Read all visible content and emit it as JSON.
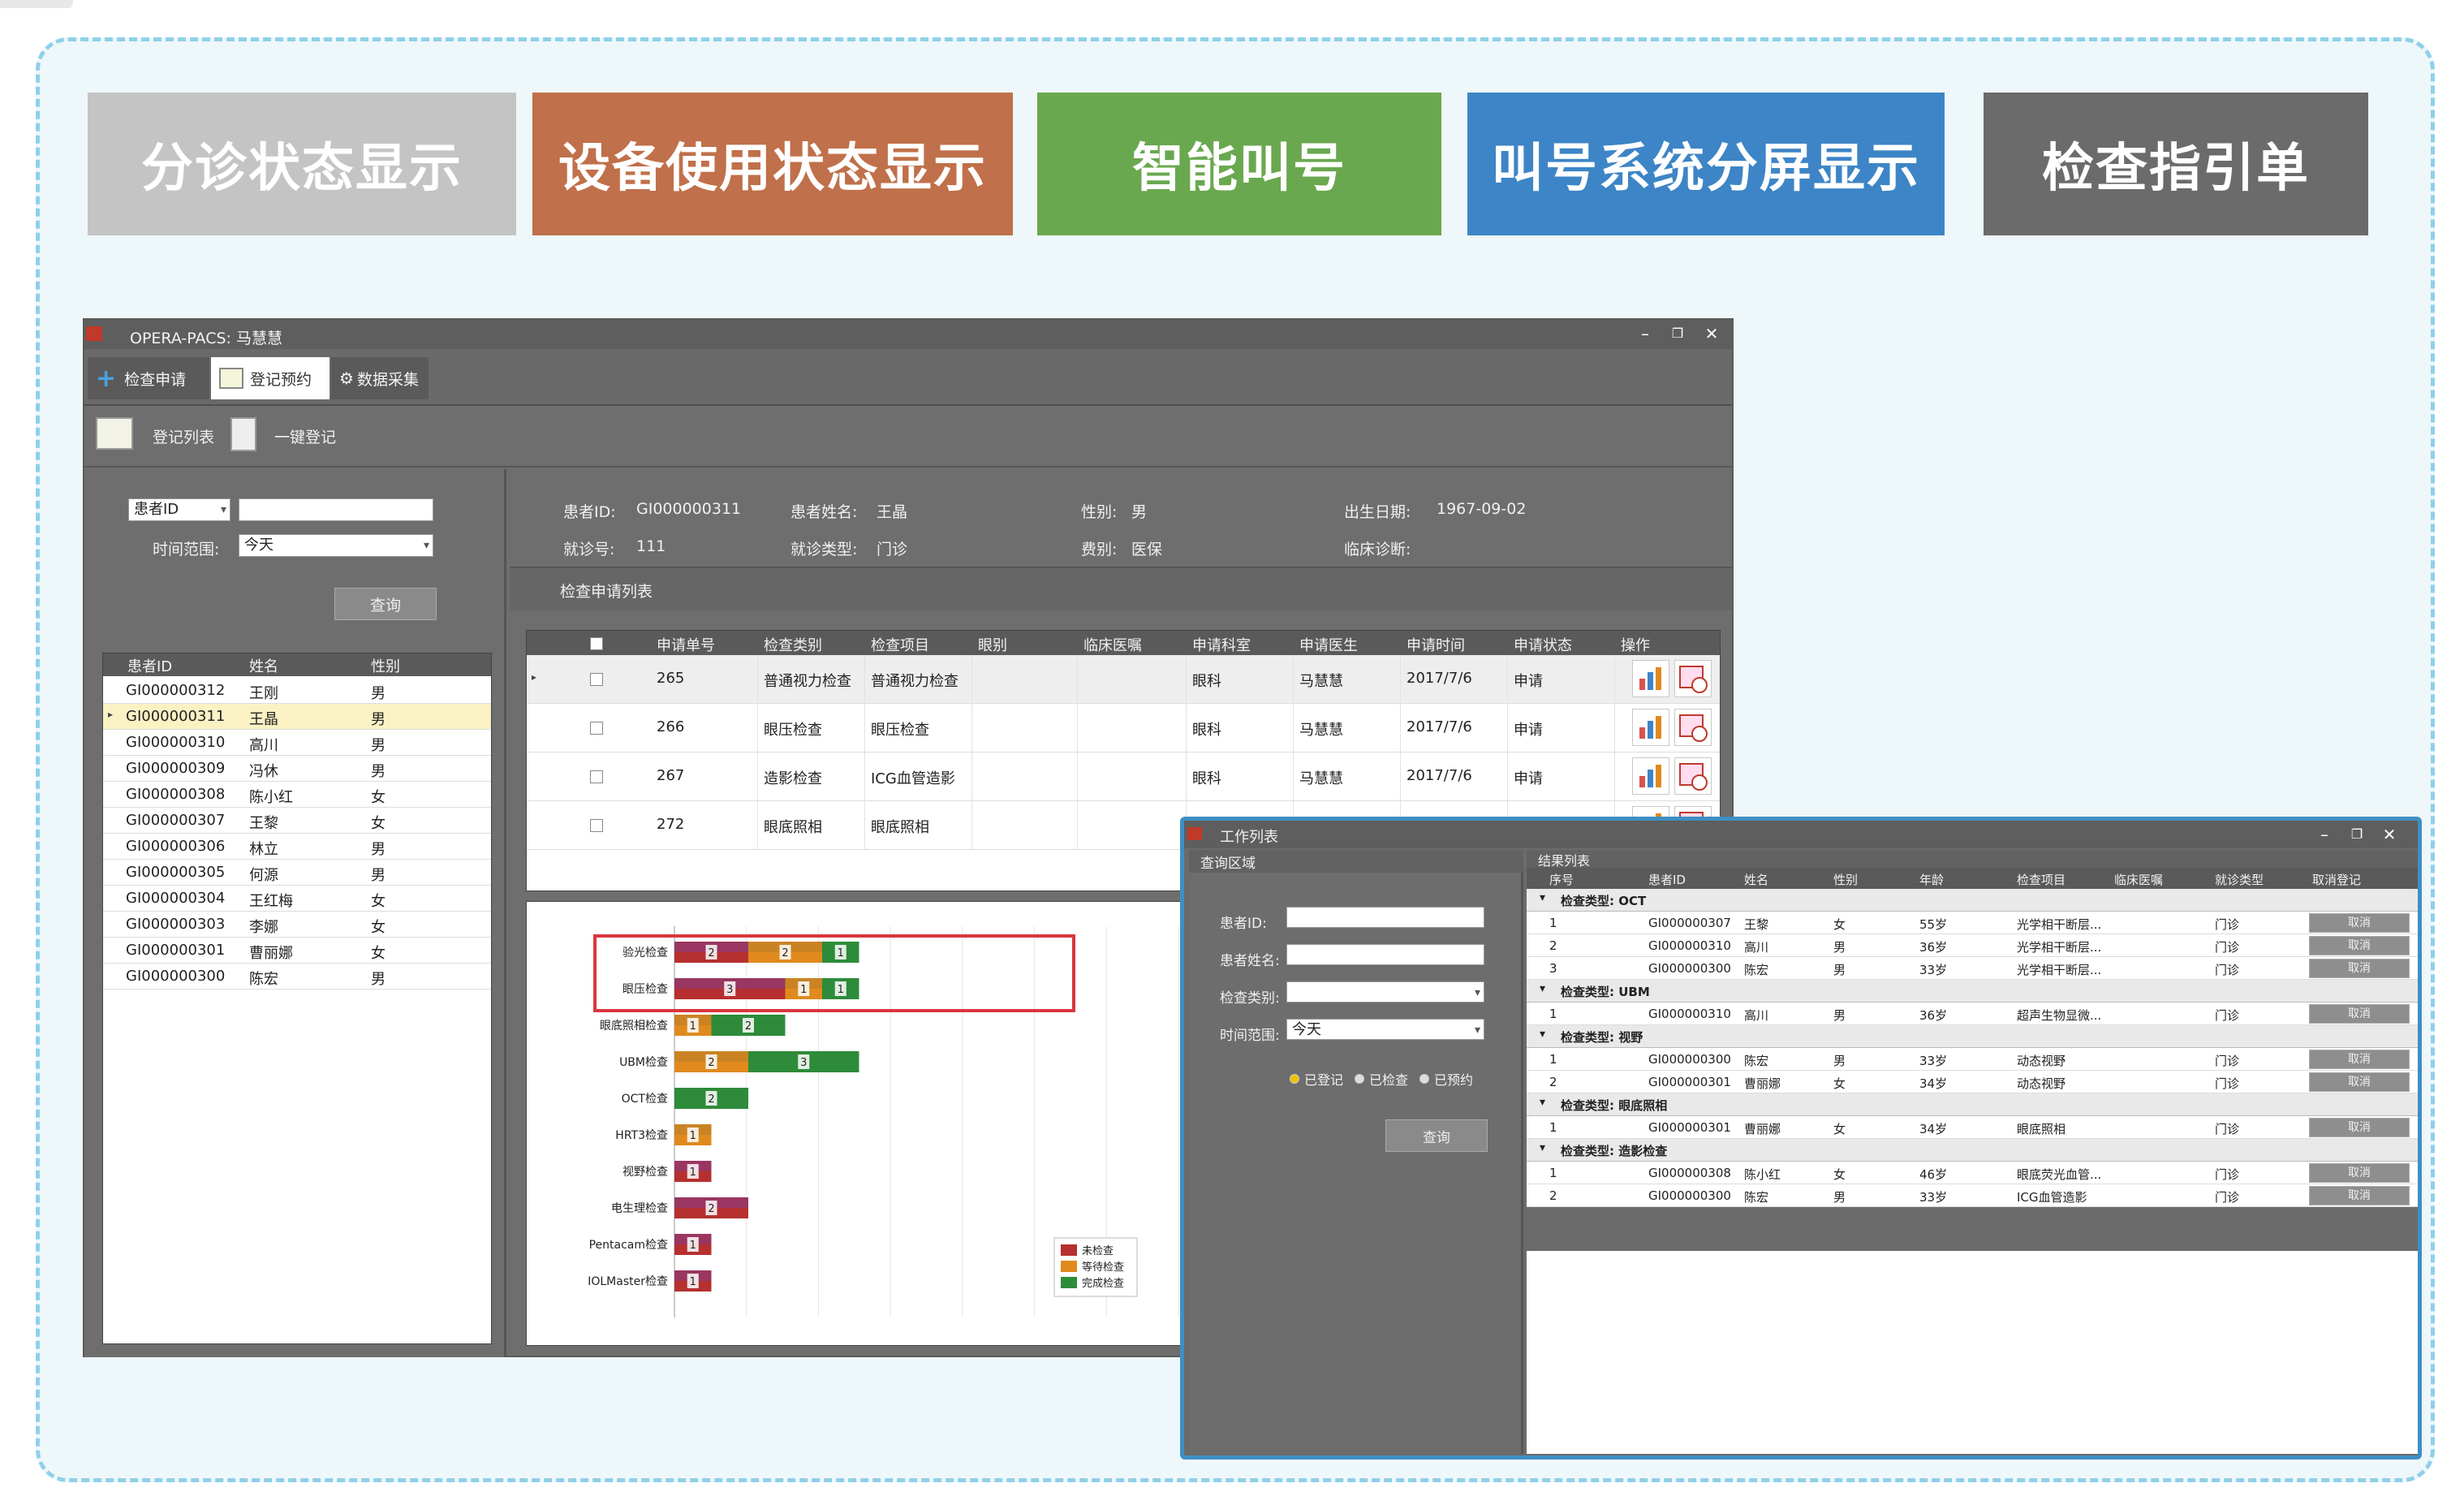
{
  "tiles": [
    {
      "label": "分诊状态显示",
      "color": "#c4c4c4"
    },
    {
      "label": "设备使用状态显示",
      "color": "#c0704a"
    },
    {
      "label": "智能叫号",
      "color": "#6aa84f"
    },
    {
      "label": "叫号系统分屏显示",
      "color": "#3d85c6"
    },
    {
      "label": "检查指引单",
      "color": "#6b6b6b"
    }
  ],
  "main_window": {
    "title": "OPERA-PACS: 马慧慧",
    "tabs": [
      "检查申请",
      "登记预约",
      "数据采集"
    ],
    "toolbar": [
      "登记列表",
      "一键登记"
    ],
    "search": {
      "field_select": "患者ID",
      "field_value": "",
      "time_label": "时间范围:",
      "time_value": "今天",
      "query_button": "查询"
    },
    "patient_grid": {
      "headers": [
        "患者ID",
        "姓名",
        "性别"
      ],
      "rows": [
        [
          "GI000000312",
          "王刚",
          "男"
        ],
        [
          "GI000000311",
          "王晶",
          "男"
        ],
        [
          "GI000000310",
          "高川",
          "男"
        ],
        [
          "GI000000309",
          "冯休",
          "男"
        ],
        [
          "GI000000308",
          "陈小红",
          "女"
        ],
        [
          "GI000000307",
          "王黎",
          "女"
        ],
        [
          "GI000000306",
          "林立",
          "男"
        ],
        [
          "GI000000305",
          "何源",
          "男"
        ],
        [
          "GI000000304",
          "王红梅",
          "女"
        ],
        [
          "GI000000303",
          "李娜",
          "女"
        ],
        [
          "GI000000301",
          "曹丽娜",
          "女"
        ],
        [
          "GI000000300",
          "陈宏",
          "男"
        ]
      ],
      "selected_index": 1
    },
    "patient_info": {
      "id_label": "患者ID:",
      "id_value": "GI000000311",
      "name_label": "患者姓名:",
      "name_value": "王晶",
      "sex_label": "性别:",
      "sex_value": "男",
      "birth_label": "出生日期:",
      "birth_value": "1967-09-02",
      "visit_label": "就诊号:",
      "visit_value": "111",
      "visit_type_label": "就诊类型:",
      "visit_type_value": "门诊",
      "fee_label": "费别:",
      "fee_value": "医保",
      "diag_label": "临床诊断:",
      "diag_value": ""
    },
    "request_list_title": "检查申请列表",
    "request_grid": {
      "headers": [
        "申请单号",
        "检查类别",
        "检查项目",
        "眼别",
        "临床医嘱",
        "申请科室",
        "申请医生",
        "申请时间",
        "申请状态",
        "操作"
      ],
      "rows": [
        [
          "265",
          "普通视力检查",
          "普通视力检查",
          "",
          "",
          "眼科",
          "马慧慧",
          "2017/7/6",
          "申请"
        ],
        [
          "266",
          "眼压检查",
          "眼压检查",
          "",
          "",
          "眼科",
          "马慧慧",
          "2017/7/6",
          "申请"
        ],
        [
          "267",
          "造影检查",
          "ICG血管造影",
          "",
          "",
          "眼科",
          "马慧慧",
          "2017/7/6",
          "申请"
        ],
        [
          "272",
          "眼底照相",
          "眼底照相",
          "",
          "",
          "",
          "",
          "",
          ""
        ]
      ]
    }
  },
  "chart_data": {
    "type": "bar",
    "stacked": true,
    "orientation": "horizontal",
    "categories": [
      "验光检查",
      "眼压检查",
      "眼底照相检查",
      "UBM检查",
      "OCT检查",
      "HRT3检查",
      "视野检查",
      "电生理检查",
      "Pentacam检查",
      "IOLMaster检查"
    ],
    "series": [
      {
        "name": "未检查",
        "color": "#b5302f",
        "values": [
          2,
          3,
          0,
          0,
          0,
          0,
          1,
          2,
          1,
          1
        ]
      },
      {
        "name": "等待检查",
        "color": "#e08a1e",
        "values": [
          2,
          1,
          1,
          2,
          0,
          1,
          0,
          0,
          0,
          0
        ]
      },
      {
        "name": "完成检查",
        "color": "#2e8b3a",
        "values": [
          1,
          1,
          2,
          3,
          2,
          0,
          0,
          0,
          0,
          0
        ]
      }
    ],
    "highlighted": [
      "验光检查",
      "眼压检查"
    ],
    "legend_position": "bottom-right",
    "grid": true
  },
  "work_window": {
    "title": "工作列表",
    "query_area_title": "查询区域",
    "result_list_title": "结果列表",
    "form": {
      "id_label": "患者ID:",
      "id_value": "",
      "name_label": "患者姓名:",
      "name_value": "",
      "type_label": "检查类别:",
      "type_value": "",
      "time_label": "时间范围:",
      "time_value": "今天",
      "radios": [
        "已登记",
        "已检查",
        "已预约"
      ],
      "query_button": "查询"
    },
    "headers": [
      "序号",
      "患者ID",
      "姓名",
      "性别",
      "年龄",
      "检查项目",
      "临床医嘱",
      "就诊类型",
      "取消登记"
    ],
    "groups": [
      {
        "title": "检查类型: OCT",
        "rows": [
          [
            "1",
            "GI000000307",
            "王黎",
            "女",
            "55岁",
            "光学相干断层...",
            "",
            "门诊",
            "取消"
          ],
          [
            "2",
            "GI000000310",
            "高川",
            "男",
            "36岁",
            "光学相干断层...",
            "",
            "门诊",
            "取消"
          ],
          [
            "3",
            "GI000000300",
            "陈宏",
            "男",
            "33岁",
            "光学相干断层...",
            "",
            "门诊",
            "取消"
          ]
        ]
      },
      {
        "title": "检查类型: UBM",
        "rows": [
          [
            "1",
            "GI000000310",
            "高川",
            "男",
            "36岁",
            "超声生物显微...",
            "",
            "门诊",
            "取消"
          ]
        ]
      },
      {
        "title": "检查类型: 视野",
        "rows": [
          [
            "1",
            "GI000000300",
            "陈宏",
            "男",
            "33岁",
            "动态视野",
            "",
            "门诊",
            "取消"
          ],
          [
            "2",
            "GI000000301",
            "曹丽娜",
            "女",
            "34岁",
            "动态视野",
            "",
            "门诊",
            "取消"
          ]
        ]
      },
      {
        "title": "检查类型: 眼底照相",
        "rows": [
          [
            "1",
            "GI000000301",
            "曹丽娜",
            "女",
            "34岁",
            "眼底照相",
            "",
            "门诊",
            "取消"
          ]
        ]
      },
      {
        "title": "检查类型: 造影检查",
        "rows": [
          [
            "1",
            "GI000000308",
            "陈小红",
            "女",
            "46岁",
            "眼底荧光血管...",
            "",
            "门诊",
            "取消"
          ],
          [
            "2",
            "GI000000300",
            "陈宏",
            "男",
            "33岁",
            "ICG血管造影",
            "",
            "门诊",
            "取消"
          ]
        ]
      }
    ]
  }
}
